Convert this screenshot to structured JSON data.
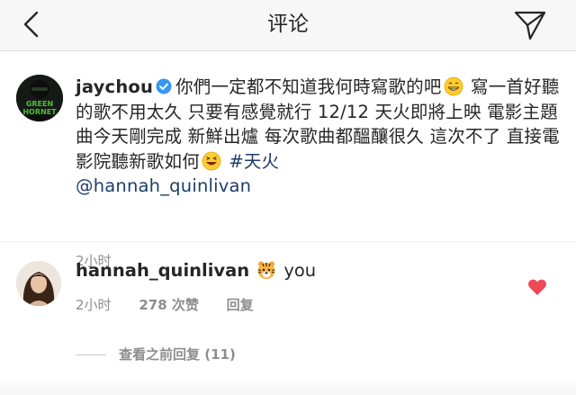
{
  "header": {
    "title": "评论"
  },
  "post": {
    "username": "jaychou",
    "caption_part1": "你們一定都不知道我何時寫歌的吧",
    "caption_part2": " 寫一首好聽的歌不用太久 只要有感覺就行 12/12 天火即將上映 電影主題曲今天剛完成 新鮮出爐 每次歌曲都醞釀很久 這次不了 直接電影院聽新歌如何",
    "hashtag": "#天火",
    "mention": "@hannah_quinlivan",
    "time": "2小时",
    "avatar_text_line1": "GREEN",
    "avatar_text_line2": "HORNET"
  },
  "comment": {
    "username": "hannah_quinlivan",
    "text": " you",
    "time": "2小时",
    "likes": "278 次赞",
    "reply_label": "回复"
  },
  "replies": {
    "label": "查看之前回复 (11)"
  },
  "colors": {
    "link": "#1d3d6b",
    "verified": "#3897f0",
    "heart": "#ed4956",
    "meta": "#8e8e8e"
  }
}
